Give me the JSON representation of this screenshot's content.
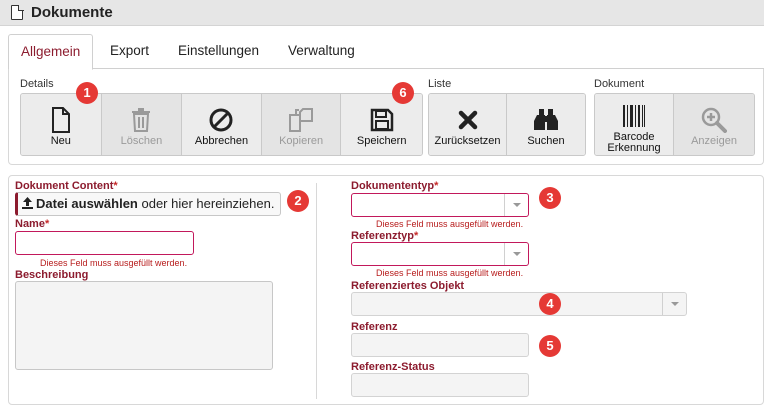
{
  "window": {
    "title": "Dokumente",
    "icon": "document-icon"
  },
  "tabs": [
    {
      "label": "Allgemein",
      "active": true
    },
    {
      "label": "Export",
      "active": false
    },
    {
      "label": "Einstellungen",
      "active": false
    },
    {
      "label": "Verwaltung",
      "active": false
    }
  ],
  "toolbar": {
    "groups": {
      "details": "Details",
      "liste": "Liste",
      "dokument": "Dokument"
    },
    "buttons": {
      "neu": {
        "label": "Neu",
        "icon": "new-file-icon",
        "enabled": true
      },
      "loeschen": {
        "label": "Löschen",
        "icon": "trash-icon",
        "enabled": false
      },
      "abbrechen": {
        "label": "Abbrechen",
        "icon": "cancel-icon",
        "enabled": true
      },
      "kopieren": {
        "label": "Kopieren",
        "icon": "copy-icon",
        "enabled": false
      },
      "speichern": {
        "label": "Speichern",
        "icon": "save-icon",
        "enabled": true
      },
      "zuruecksetzen": {
        "label": "Zurücksetzen",
        "icon": "x-icon",
        "enabled": true
      },
      "suchen": {
        "label": "Suchen",
        "icon": "binoculars-icon",
        "enabled": true
      },
      "barcode": {
        "label": "Barcode Erkennung",
        "icon": "barcode-icon",
        "enabled": true
      },
      "anzeigen": {
        "label": "Anzeigen",
        "icon": "zoom-in-icon",
        "enabled": false
      }
    }
  },
  "badges": [
    "1",
    "2",
    "3",
    "4",
    "5",
    "6"
  ],
  "form": {
    "left": {
      "content_label": "Dokument Content",
      "file_select": "Datei auswählen",
      "file_hint": " oder hier hereinziehen.",
      "name_label": "Name",
      "name_value": "",
      "name_error": "Dieses Feld muss ausgefüllt werden.",
      "description_label": "Beschreibung",
      "description_value": ""
    },
    "right": {
      "doctype_label": "Dokumententyp",
      "doctype_value": "",
      "doctype_error": "Dieses Feld muss ausgefüllt werden.",
      "reftype_label": "Referenztyp",
      "reftype_value": "",
      "reftype_error": "Dieses Feld muss ausgefüllt werden.",
      "refobj_label": "Referenziertes Objekt",
      "refobj_value": "",
      "ref_label": "Referenz",
      "ref_value": "",
      "refstatus_label": "Referenz-Status",
      "refstatus_value": ""
    },
    "required_marker": "*"
  },
  "colors": {
    "accent": "#8c1b2e",
    "badge": "#e53935",
    "error": "#b71c1c"
  }
}
